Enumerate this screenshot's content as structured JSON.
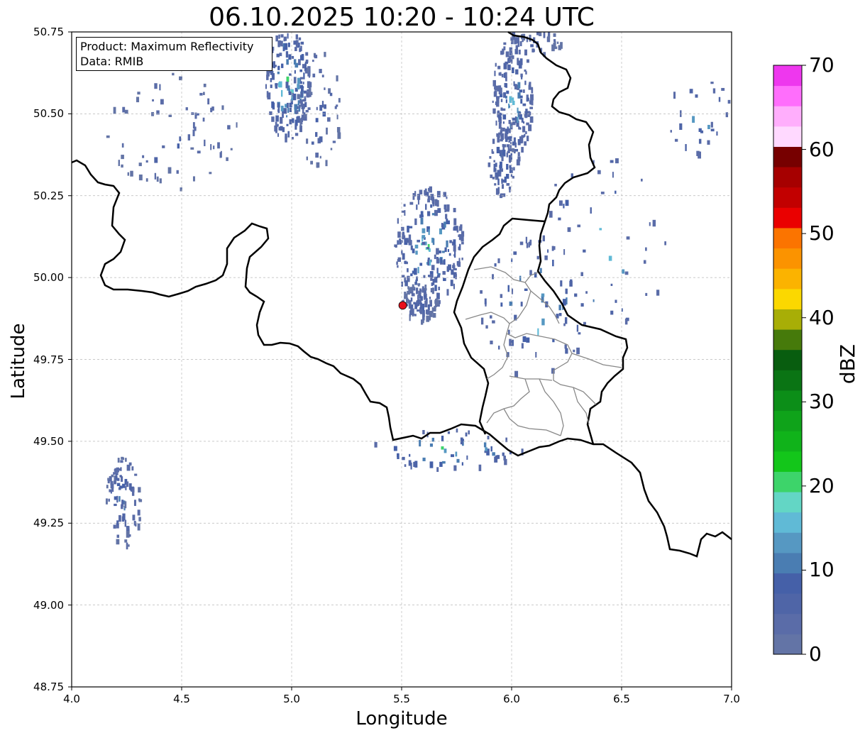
{
  "title": "06.10.2025 10:20 - 10:24 UTC",
  "info": {
    "product": "Product: Maximum Reflectivity",
    "data": "Data: RMIB"
  },
  "axes": {
    "xlabel": "Longitude",
    "ylabel": "Latitude",
    "xlim": [
      4.0,
      7.0
    ],
    "ylim": [
      48.75,
      50.75
    ],
    "xticks": [
      "4.0",
      "4.5",
      "5.0",
      "5.5",
      "6.0",
      "6.5",
      "7.0"
    ],
    "xtick_values": [
      4.0,
      4.5,
      5.0,
      5.5,
      6.0,
      6.5,
      7.0
    ],
    "yticks": [
      "50.75",
      "50.50",
      "50.25",
      "50.00",
      "49.75",
      "49.50",
      "49.25",
      "49.00",
      "48.75"
    ],
    "ytick_values": [
      50.75,
      50.5,
      50.25,
      50.0,
      49.75,
      49.5,
      49.25,
      49.0,
      48.75
    ],
    "grid": true
  },
  "radar_site": {
    "lon": 5.505,
    "lat": 49.915,
    "color": "#e8101c"
  },
  "colorbar": {
    "label": "dBZ",
    "range": [
      0,
      70
    ],
    "tick_labels": [
      "0",
      "10",
      "20",
      "30",
      "40",
      "50",
      "60",
      "70"
    ],
    "tick_values": [
      0,
      10,
      20,
      30,
      40,
      50,
      60,
      70
    ],
    "colors": [
      "#6374a6",
      "#5a6ca8",
      "#4f65a7",
      "#4560a8",
      "#4a7db2",
      "#5698c2",
      "#60bad6",
      "#63d6c5",
      "#3dd46a",
      "#13c61a",
      "#10b31a",
      "#0fa31a",
      "#0c8e18",
      "#0a7414",
      "#085d0f",
      "#467a0b",
      "#a8ae06",
      "#fbd800",
      "#fbb300",
      "#fb9300",
      "#fb7400",
      "#ea0000",
      "#c20000",
      "#a60000",
      "#770000",
      "#ffd9ff",
      "#ffaefc",
      "#ff6efc",
      "#ee37ee"
    ]
  },
  "echo_clusters": [
    {
      "lon": 4.98,
      "lat": 50.6,
      "rlon": 0.1,
      "rlat": 0.18,
      "n": 220,
      "max_dbz": 24
    },
    {
      "lon": 5.12,
      "lat": 50.52,
      "rlon": 0.1,
      "rlat": 0.18,
      "n": 70,
      "max_dbz": 12
    },
    {
      "lon": 4.45,
      "lat": 50.45,
      "rlon": 0.3,
      "rlat": 0.18,
      "n": 90,
      "max_dbz": 10
    },
    {
      "lon": 5.62,
      "lat": 50.1,
      "rlon": 0.16,
      "rlat": 0.18,
      "n": 260,
      "max_dbz": 22
    },
    {
      "lon": 5.58,
      "lat": 49.93,
      "rlon": 0.08,
      "rlat": 0.06,
      "n": 90,
      "max_dbz": 10
    },
    {
      "lon": 6.0,
      "lat": 50.55,
      "rlon": 0.09,
      "rlat": 0.2,
      "n": 230,
      "max_dbz": 18
    },
    {
      "lon": 5.95,
      "lat": 50.35,
      "rlon": 0.06,
      "rlat": 0.1,
      "n": 80,
      "max_dbz": 16
    },
    {
      "lon": 6.12,
      "lat": 50.72,
      "rlon": 0.1,
      "rlat": 0.04,
      "n": 40,
      "max_dbz": 12
    },
    {
      "lon": 6.1,
      "lat": 49.92,
      "rlon": 0.25,
      "rlat": 0.22,
      "n": 90,
      "max_dbz": 24
    },
    {
      "lon": 4.23,
      "lat": 49.32,
      "rlon": 0.08,
      "rlat": 0.14,
      "n": 120,
      "max_dbz": 14
    },
    {
      "lon": 5.7,
      "lat": 49.48,
      "rlon": 0.35,
      "rlat": 0.06,
      "n": 70,
      "max_dbz": 24
    },
    {
      "lon": 6.4,
      "lat": 50.1,
      "rlon": 0.3,
      "rlat": 0.3,
      "n": 60,
      "max_dbz": 22
    },
    {
      "lon": 6.85,
      "lat": 50.5,
      "rlon": 0.15,
      "rlat": 0.12,
      "n": 30,
      "max_dbz": 22
    }
  ]
}
